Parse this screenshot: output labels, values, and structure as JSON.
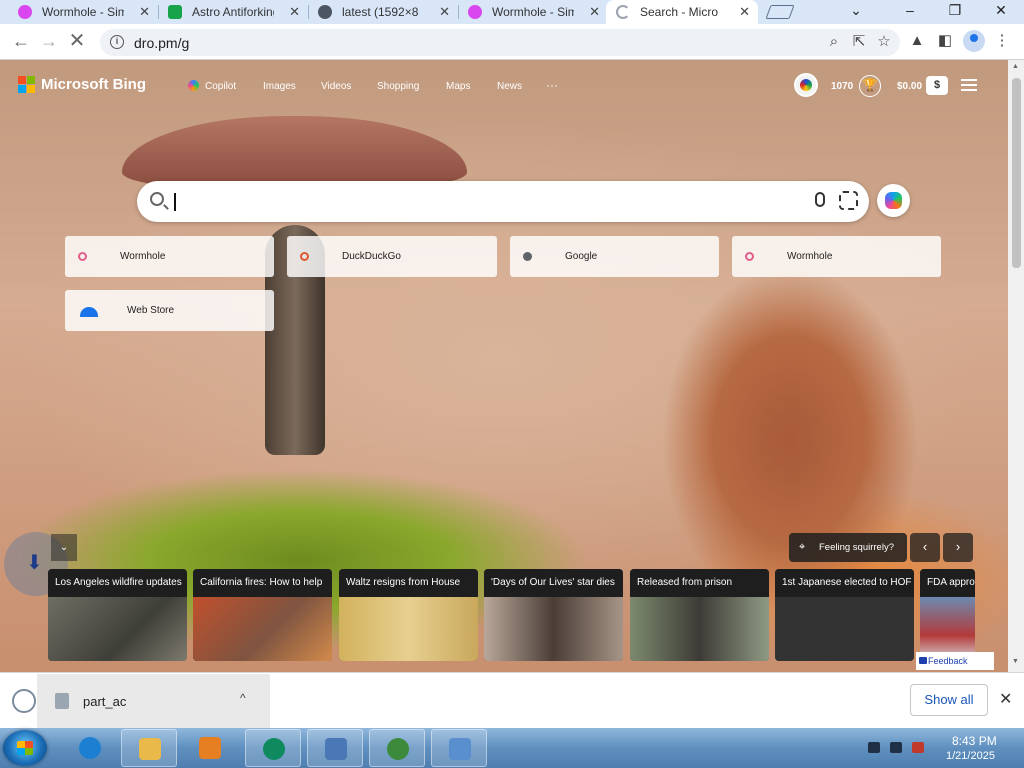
{
  "tabs": [
    {
      "title": "Wormhole - Sim",
      "favicon_color": "#d946ef",
      "active": false
    },
    {
      "title": "Astro Antiforking",
      "favicon_color": "#16a34a",
      "active": false
    },
    {
      "title": "latest (1592×8",
      "favicon_color": "#4b5563",
      "active": false
    },
    {
      "title": "Wormhole - Sim",
      "favicon_color": "#d946ef",
      "active": false
    },
    {
      "title": "Search - Micro",
      "favicon_color": "#9ca3af",
      "active": true
    }
  ],
  "address_bar": {
    "url": "dro.pm/g"
  },
  "bing": {
    "brand": "Microsoft Bing",
    "nav": [
      "Copilot",
      "Images",
      "Videos",
      "Shopping",
      "Maps",
      "News",
      "···"
    ],
    "points": "1070",
    "money": "$0.00",
    "dollar_badge": "$",
    "search": {
      "placeholder": ""
    },
    "tiles": [
      {
        "label": "Wormhole",
        "icon_color": "#e35d8c"
      },
      {
        "label": "DuckDuckGo",
        "icon_color": "#de5833"
      },
      {
        "label": "Google",
        "icon_color": "#5f6368"
      },
      {
        "label": "Wormhole",
        "icon_color": "#e35d8c"
      },
      {
        "label": "Web Store",
        "icon_color": "#1a73e8"
      }
    ],
    "feeling": "Feeling squirrely?",
    "prev_arrow": "‹",
    "next_arrow": "›",
    "collapse": "⌄",
    "news": [
      {
        "headline": "Los Angeles wildfire updates",
        "img_color": "#5b5b55"
      },
      {
        "headline": "California fires: How to help",
        "img_color": "#a85a3a"
      },
      {
        "headline": "Waltz resigns from House",
        "img_color": "#c9a85c"
      },
      {
        "headline": "'Days of Our Lives' star dies",
        "img_color": "#8c7b70"
      },
      {
        "headline": "Released from prison",
        "img_color": "#6f7a63"
      },
      {
        "headline": "1st Japanese elected to HOF",
        "img_color": "#3b3b3b"
      },
      {
        "headline": "FDA approv",
        "img_color": "#b33a3a"
      }
    ],
    "feedback": "Feedback"
  },
  "downloads": {
    "file_name": "part_ac",
    "show_all": "Show all",
    "close": "✕",
    "chevron": "^"
  },
  "taskbar": {
    "time": "8:43 PM",
    "date": "1/21/2025",
    "apps": [
      {
        "name": "internet-explorer",
        "color": "#1d7fd1"
      },
      {
        "name": "file-explorer",
        "color": "#e9b949"
      },
      {
        "name": "media-player",
        "color": "#e67e22"
      },
      {
        "name": "bing-app",
        "color": "#0f8a5f"
      },
      {
        "name": "computer-app",
        "color": "#4a78b6"
      },
      {
        "name": "chrome-app",
        "color": "#3c8b3c"
      },
      {
        "name": "control-panel",
        "color": "#5a8fcf"
      }
    ]
  }
}
